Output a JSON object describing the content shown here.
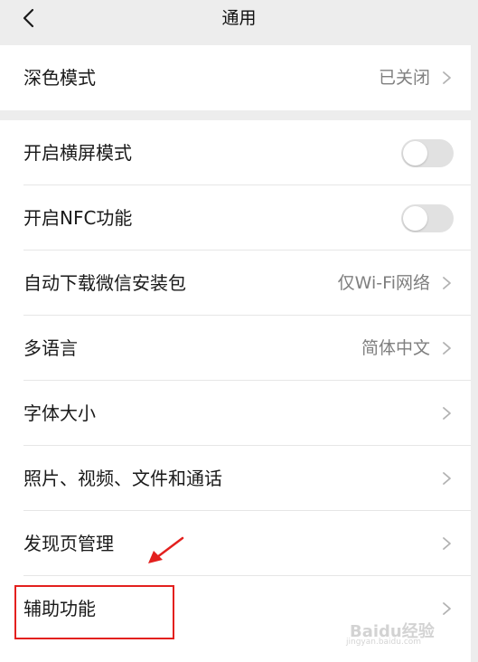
{
  "navbar": {
    "title": "通用"
  },
  "groups": [
    {
      "rows": [
        {
          "label": "深色模式",
          "value": "已关闭"
        }
      ]
    },
    {
      "rows": [
        {
          "label": "开启横屏模式",
          "toggle": false
        },
        {
          "label": "开启NFC功能",
          "toggle": false
        },
        {
          "label": "自动下载微信安装包",
          "value": "仅Wi-Fi网络"
        },
        {
          "label": "多语言",
          "value": "简体中文"
        },
        {
          "label": "字体大小"
        },
        {
          "label": "照片、视频、文件和通话"
        },
        {
          "label": "发现页管理"
        },
        {
          "label": "辅助功能"
        }
      ]
    }
  ],
  "annotation": {
    "highlight_color": "#e3201e",
    "highlighted_item": "辅助功能"
  },
  "watermark": {
    "text": "Baidu经验",
    "subtext": "jingyan.baidu.com"
  },
  "colors": {
    "background": "#ededed",
    "row_background": "#ffffff",
    "value_text": "#7f7f7f",
    "toggle_off": "#e1e1e1"
  }
}
